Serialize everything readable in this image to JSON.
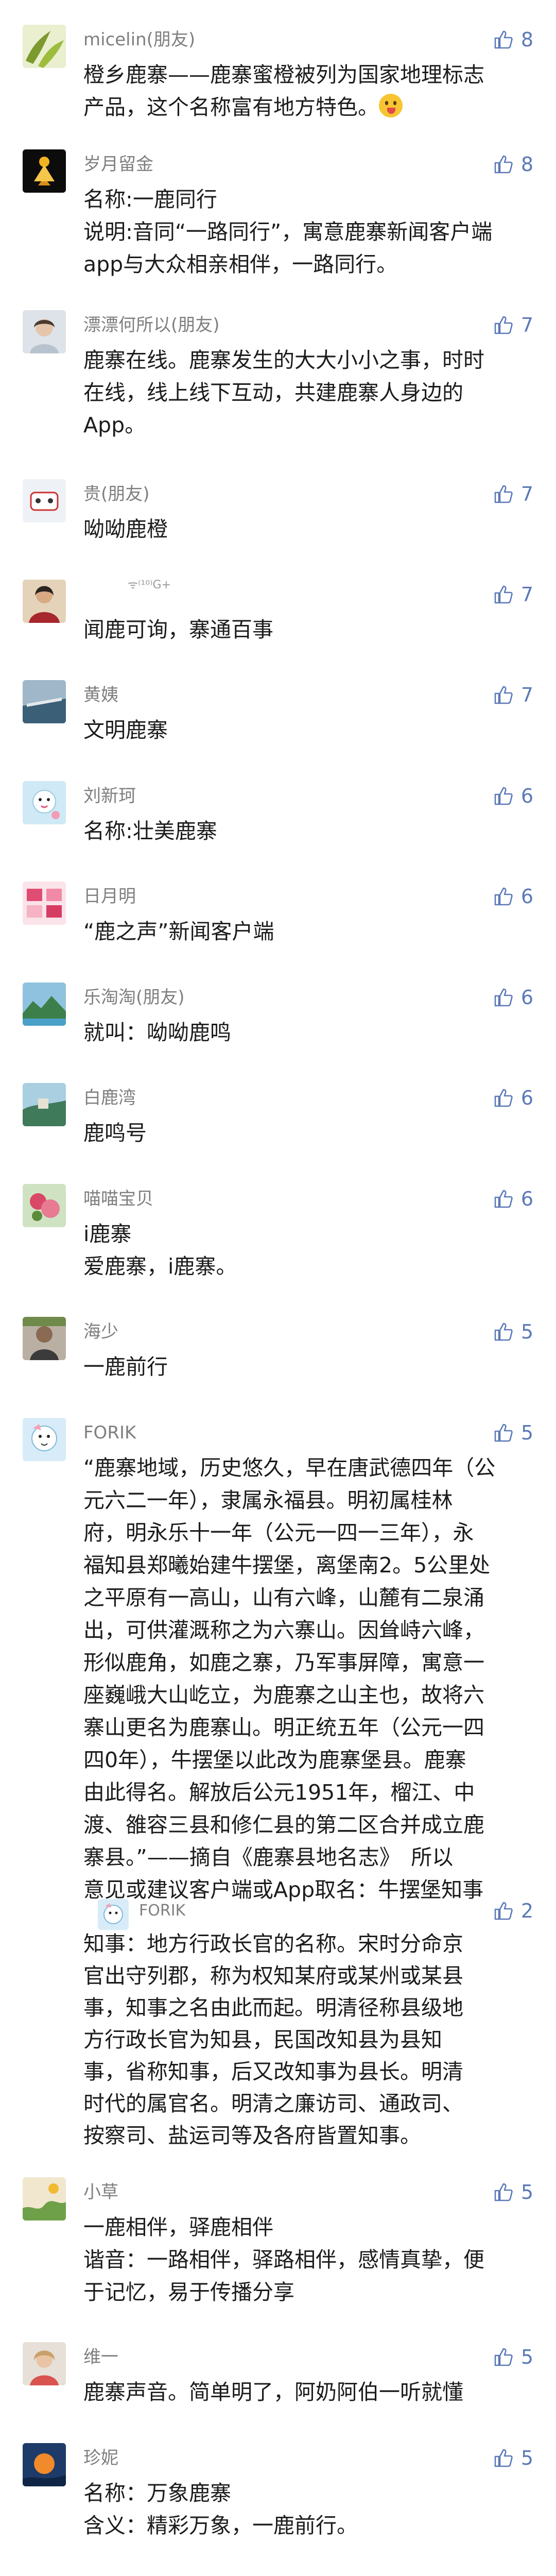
{
  "comments": [
    {
      "name": "micelin(朋友)",
      "likes": "8",
      "lines": [
        "橙乡鹿寨——鹿寨蜜橙被列为国家地理标志",
        "产品，这个名称富有地方特色。"
      ]
    },
    {
      "name": "岁月留金",
      "likes": "8",
      "lines": [
        "名称:一鹿同行",
        "说明:音同“一路同行”，寓意鹿寨新闻客户端",
        "app与大众相亲相伴，一路同行。"
      ]
    },
    {
      "name": "漂漂何所以(朋友)",
      "likes": "7",
      "lines": [
        "鹿寨在线。鹿寨发生的大大小小之事，时时",
        "在线，线上线下互动，共建鹿寨人身边的",
        "App。"
      ]
    },
    {
      "name": "贵(朋友)",
      "likes": "7",
      "lines": [
        "呦呦鹿橙"
      ]
    },
    {
      "name": "",
      "name_extra": "ᯤ⁽¹⁰⁾G+",
      "likes": "7",
      "lines": [
        "闻鹿可询，寨通百事"
      ]
    },
    {
      "name": "黄姨",
      "likes": "7",
      "lines": [
        "文明鹿寨"
      ]
    },
    {
      "name": "刘新珂",
      "likes": "6",
      "lines": [
        "名称:壮美鹿寨"
      ]
    },
    {
      "name": "日月明",
      "likes": "6",
      "lines": [
        "“鹿之声”新闻客户端"
      ]
    },
    {
      "name": "乐淘淘(朋友)",
      "likes": "6",
      "lines": [
        "就叫：呦呦鹿鸣"
      ]
    },
    {
      "name": "白鹿湾",
      "likes": "6",
      "lines": [
        "鹿鸣号"
      ]
    },
    {
      "name": "喵喵宝贝",
      "likes": "6",
      "lines": [
        "i鹿寨",
        "爱鹿寨，i鹿寨。"
      ]
    },
    {
      "name": "海少",
      "likes": "5",
      "lines": [
        "一鹿前行"
      ]
    },
    {
      "name": "FORIK",
      "likes": "5",
      "lines": [
        "“鹿寨地域，历史悠久，早在唐武德四年（公",
        "元六二一年），隶属永福县。明初属桂林",
        "府，明永乐十一年（公元一四一三年），永",
        "福知县郑曦始建牛摆堡，离堡南2。5公里处",
        "之平原有一高山，山有六峰，山麓有二泉涌",
        "出，可供灌溉称之为六寨山。因耸峙六峰，",
        "形似鹿角，如鹿之寨，乃军事屏障，寓意一",
        "座巍峨大山屹立，为鹿寨之山主也，故将六",
        "寨山更名为鹿寨山。明正统五年（公元一四",
        "四0年），牛摆堡以此改为鹿寨堡县。鹿寨",
        "由此得名。解放后公元1951年，榴江、中",
        "渡、雒容三县和修仁县的第二区合并成立鹿",
        "寨县。”——摘自《鹿寨县地名志》　所以",
        "意见或建议客户端或App取名：牛摆堡知事"
      ]
    },
    {
      "name": "FORIK",
      "likes": "2",
      "lines": [
        "知事：地方行政长官的名称。宋时分命京",
        "官出守列郡，称为权知某府或某州或某县",
        "事，知事之名由此而起。明清径称县级地",
        "方行政长官为知县，民国改知县为县知",
        "事，省称知事，后又改知事为县长。明清",
        "时代的属官名。明清之廉访司、通政司、",
        "按察司、盐运司等及各府皆置知事。"
      ]
    },
    {
      "name": "小草",
      "likes": "5",
      "lines": [
        "一鹿相伴，驿鹿相伴",
        "谐音：一路相伴，驿路相伴，感情真挚，便",
        "于记忆，易于传播分享"
      ]
    },
    {
      "name": "维一",
      "likes": "5",
      "lines": [
        "鹿寨声音。简单明了，阿奶阿伯一听就懂"
      ]
    },
    {
      "name": "珍妮",
      "likes": "5",
      "lines": [
        "名称：万象鹿寨",
        "含义：精彩万象，一鹿前行。"
      ]
    }
  ]
}
